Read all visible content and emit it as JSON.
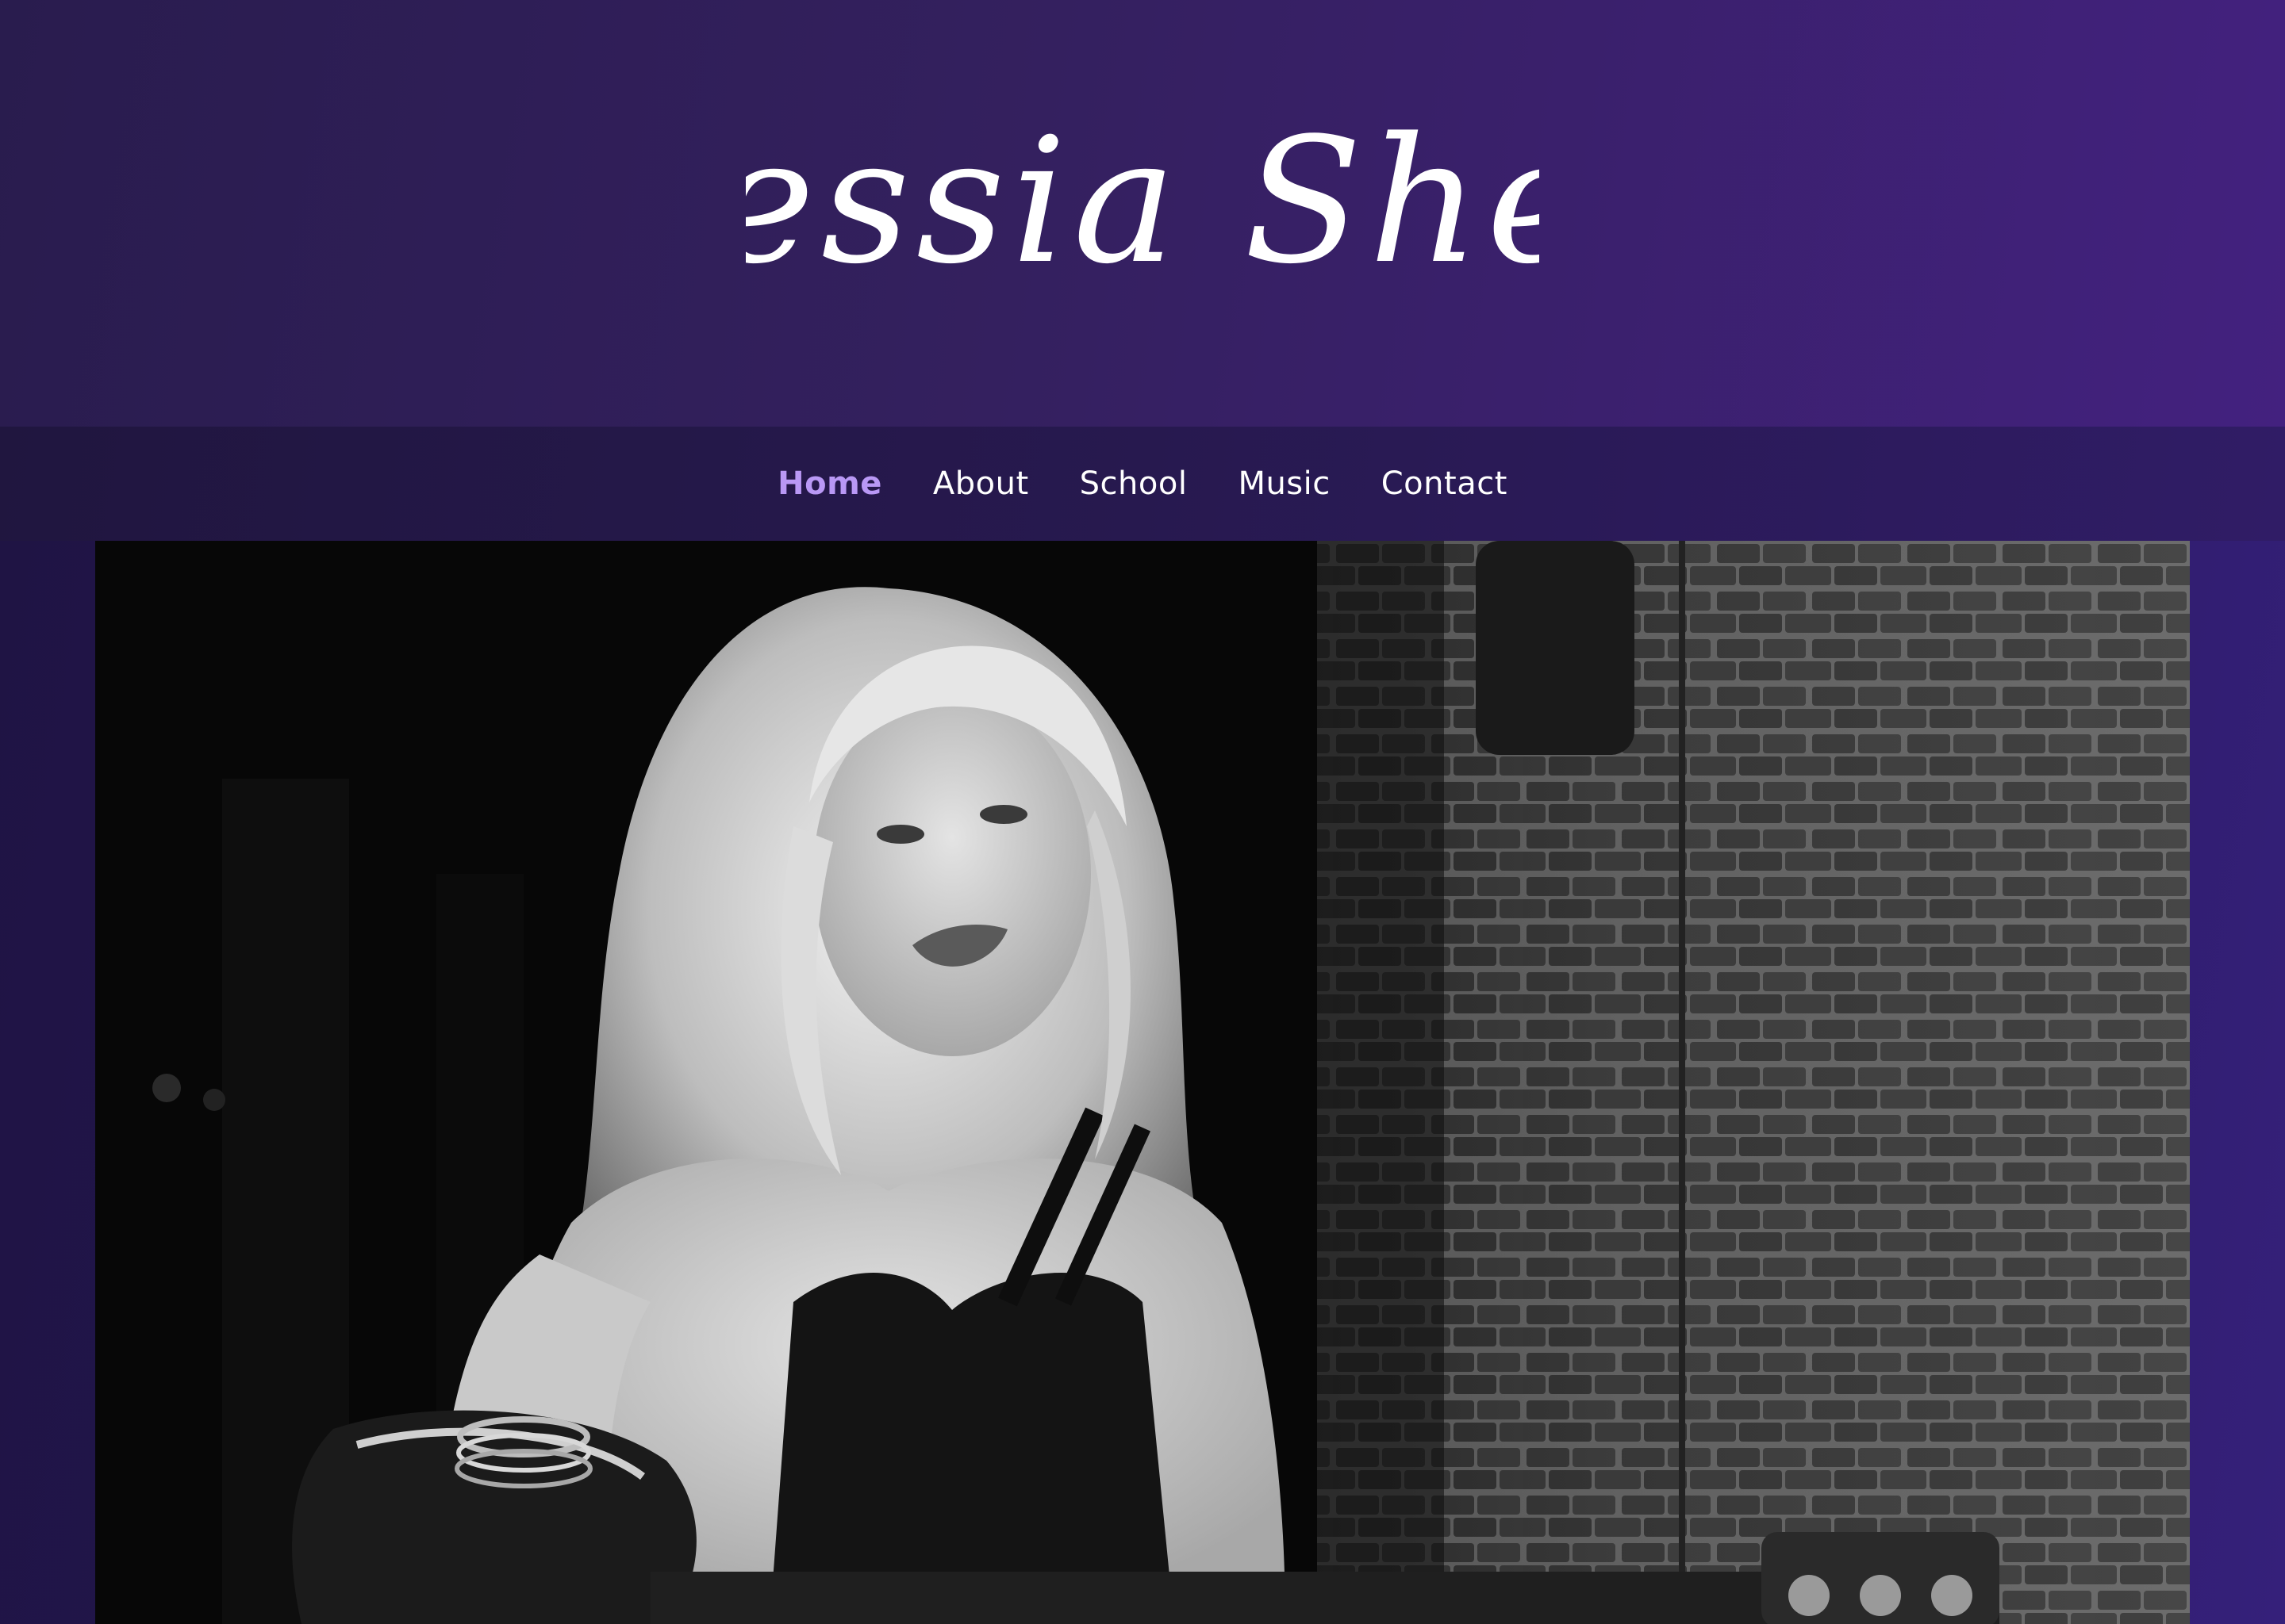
{
  "site": {
    "title": "Alessia Shem",
    "colors": {
      "header_start": "#291c4e",
      "header_end": "#43217f",
      "nav_active": "#b998f5",
      "nav_text": "#ffffff"
    }
  },
  "nav": {
    "items": [
      {
        "label": "Home",
        "active": true
      },
      {
        "label": "About",
        "active": false
      },
      {
        "label": "School",
        "active": false
      },
      {
        "label": "Music",
        "active": false
      },
      {
        "label": "Contact",
        "active": false
      }
    ]
  },
  "hero": {
    "image": "black-and-white-photo-woman-with-acoustic-guitar-brick-wall"
  }
}
